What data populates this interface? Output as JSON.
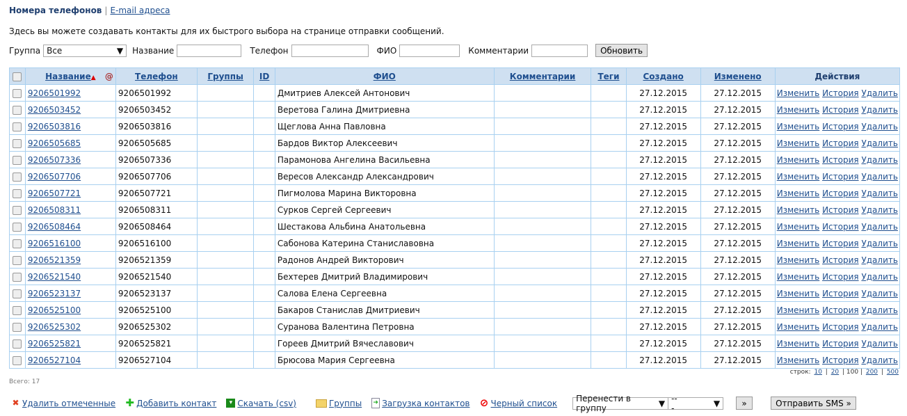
{
  "tabs": {
    "active": "Номера телефонов",
    "other": "E-mail адреса"
  },
  "intro": "Здесь вы можете создавать контакты для их быстрого выбора на странице отправки сообщений.",
  "filters": {
    "group_label": "Группа",
    "group_value": "Все",
    "name_label": "Название",
    "phone_label": "Телефон",
    "fio_label": "ФИО",
    "comment_label": "Комментарии",
    "refresh": "Обновить"
  },
  "columns": {
    "name": "Название",
    "email": "@",
    "phone": "Телефон",
    "groups": "Группы",
    "id": "ID",
    "fio": "ФИО",
    "comments": "Комментарии",
    "tags": "Теги",
    "created": "Создано",
    "modified": "Изменено",
    "actions": "Действия"
  },
  "actions": {
    "edit": "Изменить",
    "history": "История",
    "delete": "Удалить"
  },
  "rows": [
    {
      "name": "9206501992",
      "phone": "9206501992",
      "fio": "Дмитриев Алексей Антонович",
      "created": "27.12.2015",
      "modified": "27.12.2015"
    },
    {
      "name": "9206503452",
      "phone": "9206503452",
      "fio": "Веретова Галина Дмитриевна",
      "created": "27.12.2015",
      "modified": "27.12.2015"
    },
    {
      "name": "9206503816",
      "phone": "9206503816",
      "fio": "Щеглова Анна Павловна",
      "created": "27.12.2015",
      "modified": "27.12.2015"
    },
    {
      "name": "9206505685",
      "phone": "9206505685",
      "fio": "Бардов Виктор Алексеевич",
      "created": "27.12.2015",
      "modified": "27.12.2015"
    },
    {
      "name": "9206507336",
      "phone": "9206507336",
      "fio": "Парамонова Ангелина Васильевна",
      "created": "27.12.2015",
      "modified": "27.12.2015"
    },
    {
      "name": "9206507706",
      "phone": "9206507706",
      "fio": "Вересов Александр Александрович",
      "created": "27.12.2015",
      "modified": "27.12.2015"
    },
    {
      "name": "9206507721",
      "phone": "9206507721",
      "fio": "Пигмолова Марина Викторовна",
      "created": "27.12.2015",
      "modified": "27.12.2015"
    },
    {
      "name": "9206508311",
      "phone": "9206508311",
      "fio": "Сурков Сергей Сергеевич",
      "created": "27.12.2015",
      "modified": "27.12.2015"
    },
    {
      "name": "9206508464",
      "phone": "9206508464",
      "fio": "Шестакова Альбина Анатольевна",
      "created": "27.12.2015",
      "modified": "27.12.2015"
    },
    {
      "name": "9206516100",
      "phone": "9206516100",
      "fio": "Сабонова Катерина Станиславовна",
      "created": "27.12.2015",
      "modified": "27.12.2015"
    },
    {
      "name": "9206521359",
      "phone": "9206521359",
      "fio": "Радонов Андрей Викторович",
      "created": "27.12.2015",
      "modified": "27.12.2015"
    },
    {
      "name": "9206521540",
      "phone": "9206521540",
      "fio": "Бехтерев Дмитрий Владимирович",
      "created": "27.12.2015",
      "modified": "27.12.2015"
    },
    {
      "name": "9206523137",
      "phone": "9206523137",
      "fio": "Салова Елена Сергеевна",
      "created": "27.12.2015",
      "modified": "27.12.2015"
    },
    {
      "name": "9206525100",
      "phone": "9206525100",
      "fio": "Бакаров Станислав Дмитриевич",
      "created": "27.12.2015",
      "modified": "27.12.2015"
    },
    {
      "name": "9206525302",
      "phone": "9206525302",
      "fio": "Суранова Валентина Петровна",
      "created": "27.12.2015",
      "modified": "27.12.2015"
    },
    {
      "name": "9206525821",
      "phone": "9206525821",
      "fio": "Гореев Дмитрий Вячеславович",
      "created": "27.12.2015",
      "modified": "27.12.2015"
    },
    {
      "name": "9206527104",
      "phone": "9206527104",
      "fio": "Брюсова Мария Сергеевна",
      "created": "27.12.2015",
      "modified": "27.12.2015"
    }
  ],
  "total": "Всего: 17",
  "pager": {
    "label": "строк:",
    "options": [
      "10",
      "20",
      "100",
      "200",
      "500"
    ],
    "current": "100"
  },
  "bottom": {
    "delete_checked": "Удалить отмеченные",
    "add_contact": "Добавить контакт",
    "download": "Скачать (csv)",
    "groups": "Группы",
    "upload": "Загрузка контактов",
    "blacklist": "Черный список",
    "move_select": "Перенести в группу",
    "group_select": "---",
    "go": "»",
    "send_sms": "Отправить SMS »"
  }
}
